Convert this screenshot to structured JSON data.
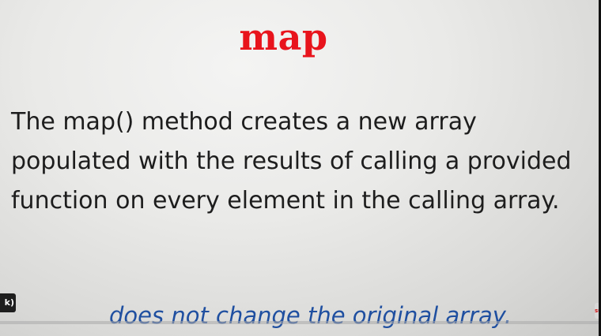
{
  "slide": {
    "title": "map",
    "body_lines": [
      "The map() method creates a new array",
      "populated with the results of calling a provided",
      "function on every element in the calling array."
    ],
    "note": "does not change the original array."
  },
  "player": {
    "left_badge": "k)",
    "right_badge": "su",
    "progress_fraction": 0.0
  },
  "colors": {
    "title": "#e8141c",
    "body": "#1d1d1d",
    "note": "#1f4fa0",
    "progress": "#e81c1c"
  }
}
